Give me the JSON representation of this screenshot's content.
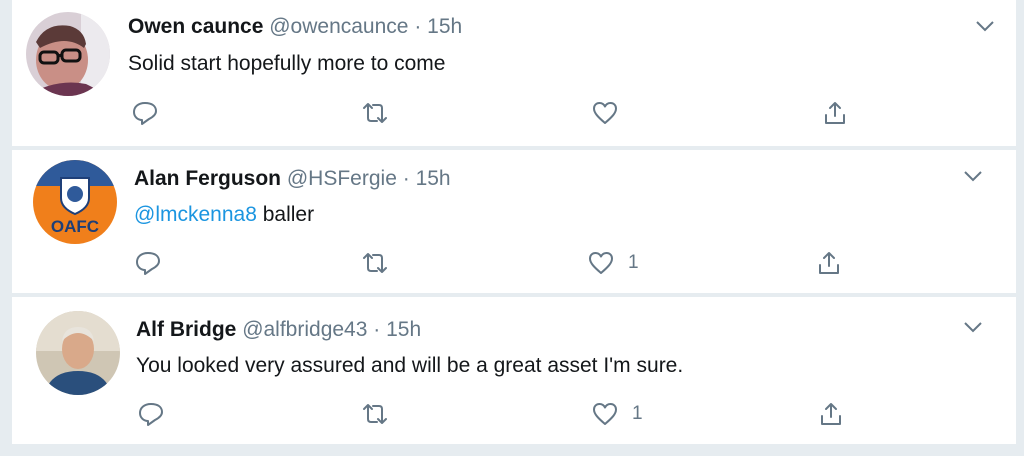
{
  "tweets": [
    {
      "name": "Owen caunce",
      "handle": "@owencaunce",
      "dot": "·",
      "time": "15h",
      "mention": "",
      "text": "Solid start hopefully more to come",
      "like_count": "",
      "avatar": "owen-avatar"
    },
    {
      "name": "Alan Ferguson",
      "handle": "@HSFergie",
      "dot": "·",
      "time": "15h",
      "mention": "@lmckenna8",
      "text": " baller",
      "like_count": "1",
      "avatar": "oafc-logo",
      "avatar_text": "OAFC"
    },
    {
      "name": "Alf Bridge",
      "handle": "@alfbridge43",
      "dot": "·",
      "time": "15h",
      "mention": "",
      "text": "You looked very assured and will be a great asset I'm sure.",
      "like_count": "1",
      "avatar": "alf-avatar"
    }
  ],
  "icons": [
    "reply-icon",
    "retweet-icon",
    "like-icon",
    "share-icon",
    "chevron-down-icon"
  ],
  "colors": {
    "background": "#e6ecf0",
    "name": "#14171a",
    "meta": "#657786",
    "link": "#1b95e0",
    "oafc_orange": "#f07f1b"
  }
}
